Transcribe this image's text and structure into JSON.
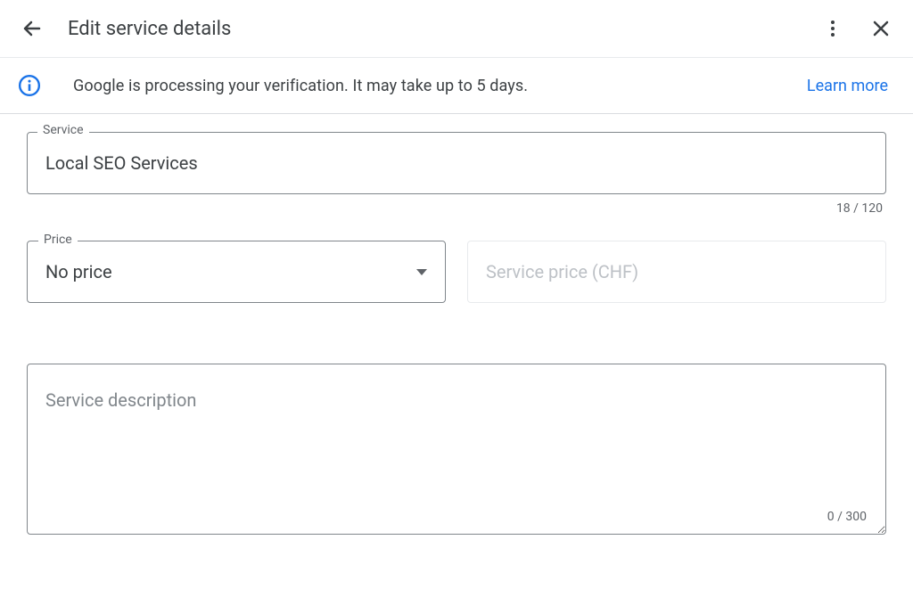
{
  "header": {
    "title": "Edit service details"
  },
  "banner": {
    "text": "Google is processing your verification. It may take up to 5 days.",
    "link": "Learn more"
  },
  "service": {
    "label": "Service",
    "value": "Local SEO Services",
    "counter": "18 / 120"
  },
  "price": {
    "label": "Price",
    "value": "No price",
    "priceInputPlaceholder": "Service price (CHF)"
  },
  "description": {
    "placeholder": "Service description",
    "counter": "0 / 300"
  }
}
